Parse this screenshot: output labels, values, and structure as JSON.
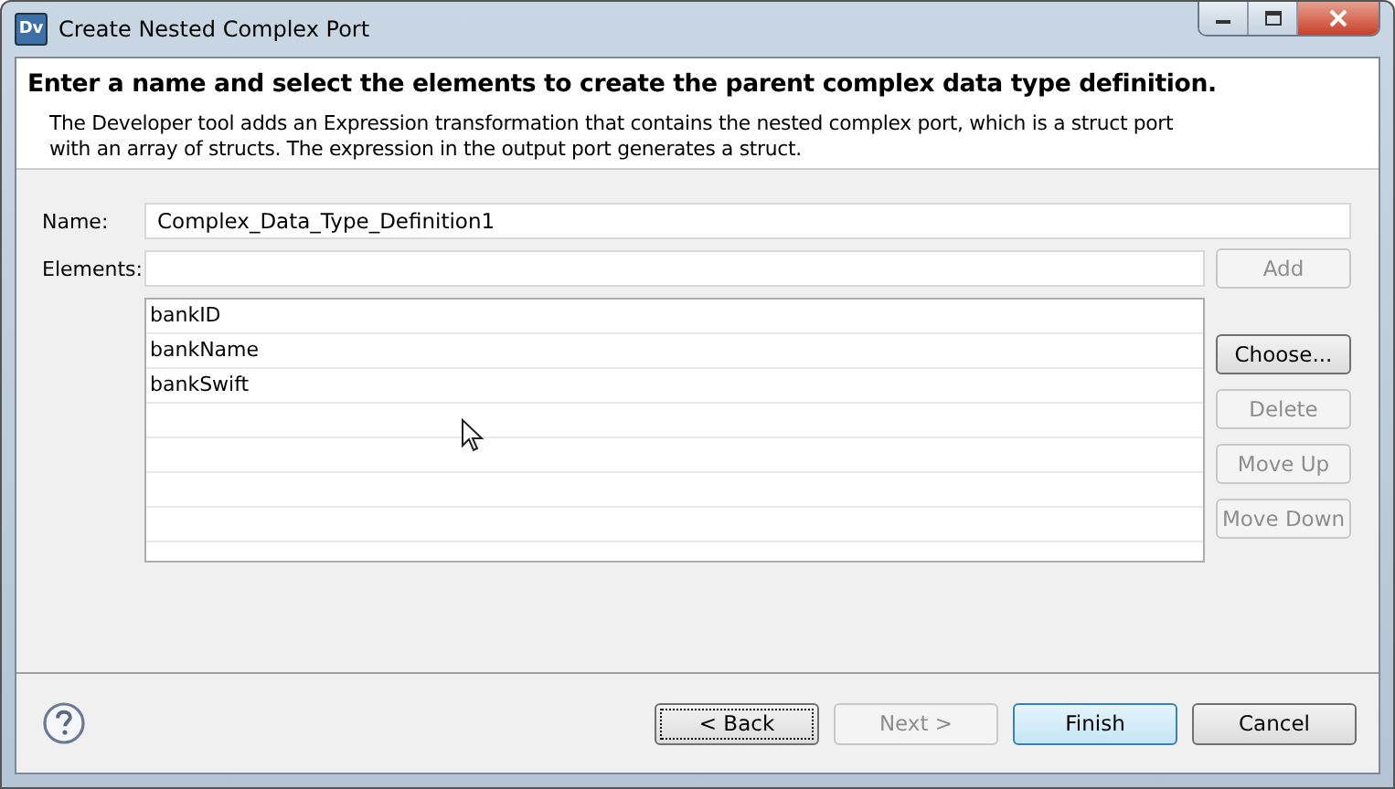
{
  "window": {
    "title": "Create Nested Complex Port",
    "app_icon": "Dv"
  },
  "header": {
    "title": "Enter a name and select the elements to create the parent complex data type definition.",
    "description": "The Developer tool adds an Expression transformation that contains the nested complex port, which is a struct port with an array of structs. The expression in the output port generates a struct."
  },
  "name_field": {
    "label": "Name:",
    "value": "Complex_Data_Type_Definition1"
  },
  "elements_field": {
    "label": "Elements:"
  },
  "elements": [
    "bankID",
    "bankName",
    "bankSwift"
  ],
  "side_buttons": [
    {
      "label": "Add",
      "disabled": true
    },
    {
      "label": "Choose...",
      "disabled": false
    },
    {
      "label": "Delete",
      "disabled": true
    },
    {
      "label": "Move Up",
      "disabled": true
    },
    {
      "label": "Move Down",
      "disabled": true
    }
  ],
  "footer_buttons": [
    {
      "label": "< Back",
      "disabled": false,
      "focused": true,
      "default": false
    },
    {
      "label": "Next >",
      "disabled": true,
      "focused": false,
      "default": false
    },
    {
      "label": "Finish",
      "disabled": false,
      "focused": false,
      "default": true
    },
    {
      "label": "Cancel",
      "disabled": false,
      "focused": false,
      "default": false
    }
  ]
}
